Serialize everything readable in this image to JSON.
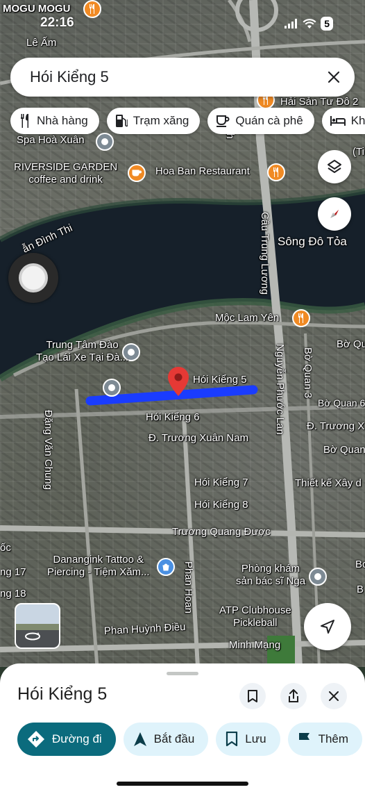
{
  "status_bar": {
    "time": "22:16",
    "battery": "5"
  },
  "search": {
    "query": "Hói Kiểng 5"
  },
  "chips": [
    {
      "icon": "fork-knife-icon",
      "label": "Nhà hàng"
    },
    {
      "icon": "gas-station-icon",
      "label": "Trạm xăng"
    },
    {
      "icon": "coffee-cup-icon",
      "label": "Quán cà phê"
    },
    {
      "icon": "bed-icon",
      "label": "Khá"
    }
  ],
  "map_labels": {
    "mogu": "MOGU MOGU",
    "le_am": "Lê Ấm",
    "hai_san": "Hải Sản Tư Đô 2",
    "spa": "Spa Hoà Xuân",
    "riverside": "RIVERSIDE GARDEN\ncoffee and drink",
    "hoa_ban": "Hoa Ban Restaurant",
    "ti": "(Ti",
    "song_do_toa": "Sông Đô Tỏa",
    "cau_trung_luong": "Cầu Trung Lương",
    "ich": "ích",
    "dinh_thi": "ẫn Đình Thi",
    "moc_lam_yen": "Mộc Lam Yên",
    "bo_qu": "Bờ Qu",
    "trung_tam": "Trung Tâm Đào\nTạo Lái Xe Tại Đà...",
    "hoi_kieng_5": "Hói Kiểng 5",
    "nguyen_phuoc_lan": "Nguyễn Phước Lan",
    "bo_quan_3": "Bờ Quan 3",
    "bo_quan_6": "Bờ Quan 6",
    "truong_x": "Đ. Trương X",
    "bo_quan": "Bờ Quan",
    "dang_van_chung": "Đặng Văn Chung",
    "hoi_kieng_6": "Hói Kiểng 6",
    "truong_xuan_nam": "Đ. Trương Xuân Nam",
    "hoi_kieng_7": "Hói Kiểng 7",
    "thiet_ke": "Thiết kế Xây d",
    "hoi_kieng_8": "Hói Kiểng 8",
    "truong_quang_duoc": "Trương Quang Được",
    "danangink": "Danangink Tattoo &\nPiercing - Tiệm Xăm...",
    "phan_hoan": "Phan Hoan",
    "phong_kham": "Phòng khám\nsản bác sĩ Nga",
    "ng_17": "ng 17",
    "ng_18": "ng 18",
    "atp": "ATP Clubhouse\nPickleball",
    "phan_huynh_dieu": "Phan Huỳnh Điều",
    "minh_mang": "Minh Mạng",
    "doc": "ốc",
    "bo": "Bo",
    "b": "B"
  },
  "sheet": {
    "title": "Hói Kiểng 5",
    "actions": [
      {
        "icon": "directions-icon",
        "label": "Đường đi"
      },
      {
        "icon": "navigation-arrow-icon",
        "label": "Bắt đầu"
      },
      {
        "icon": "bookmark-icon",
        "label": "Lưu"
      },
      {
        "icon": "flag-icon",
        "label": "Thêm"
      }
    ]
  },
  "colors": {
    "accent": "#0b6b7d",
    "route": "#1a3cff",
    "pin": "#e53935",
    "poi_food": "#f08a24"
  }
}
